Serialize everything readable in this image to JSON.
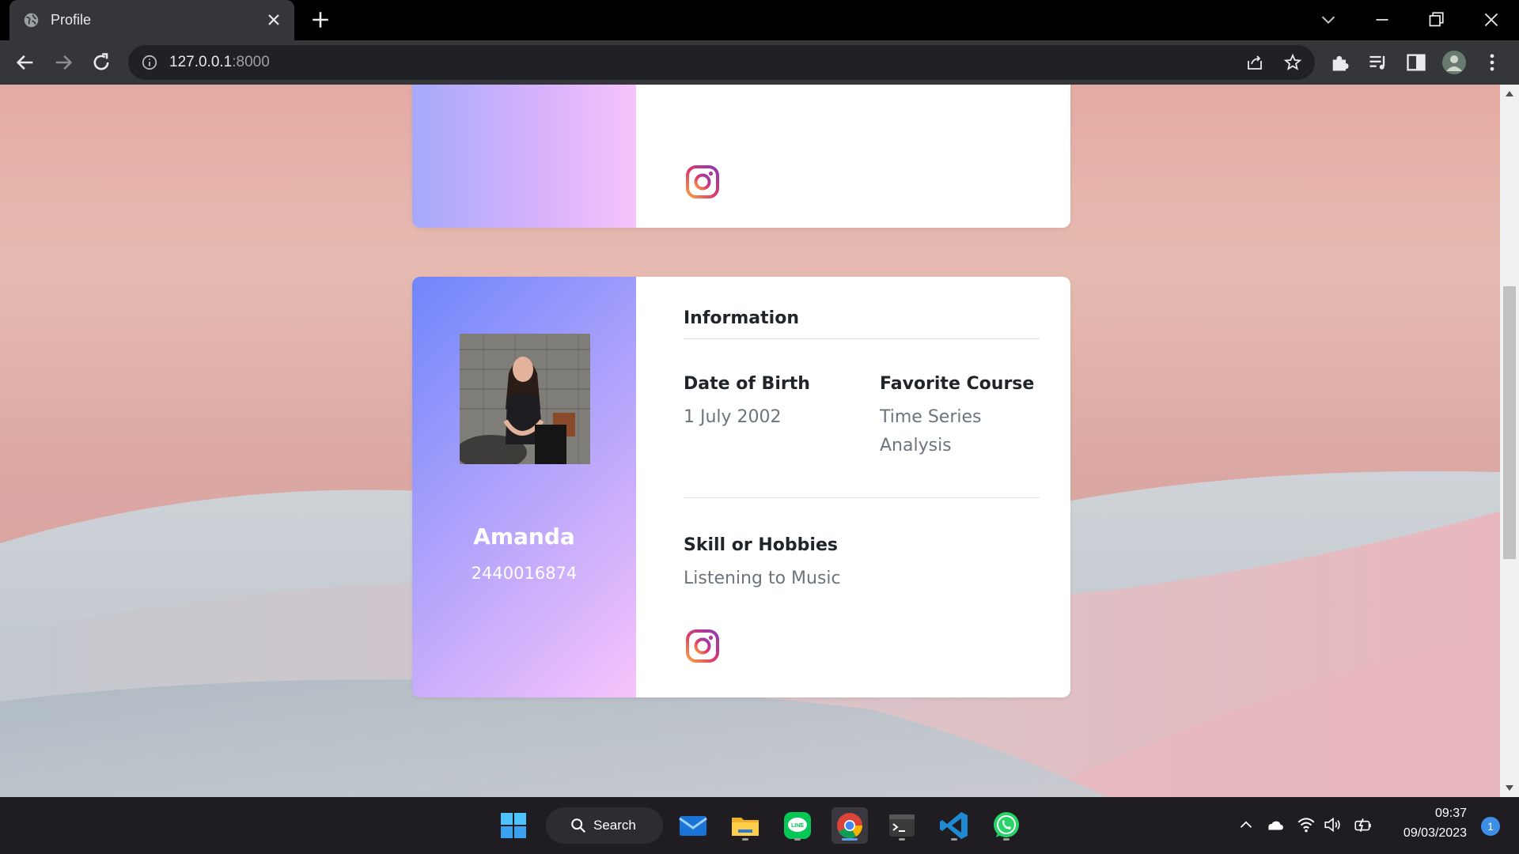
{
  "browser": {
    "tab_title": "Profile",
    "url_host": "127.0.0.1",
    "url_port": ":8000"
  },
  "profile": {
    "section_title": "Information",
    "name": "Amanda",
    "student_id": "2440016874",
    "dob_label": "Date of Birth",
    "dob_value": "1 July 2002",
    "course_label": "Favorite Course",
    "course_value_line1": "Time Series",
    "course_value_line2": "Analysis",
    "skill_label": "Skill or Hobbies",
    "skill_value": "Listening to Music"
  },
  "taskbar": {
    "search_label": "Search",
    "time": "09:37",
    "date": "09/03/2023",
    "notification_count": "1"
  },
  "colors": {
    "chrome_dark": "#35363a",
    "card_gradient_start": "#6f86fb",
    "card_gradient_end": "#f7c3fb",
    "instagram": "#c13584"
  }
}
